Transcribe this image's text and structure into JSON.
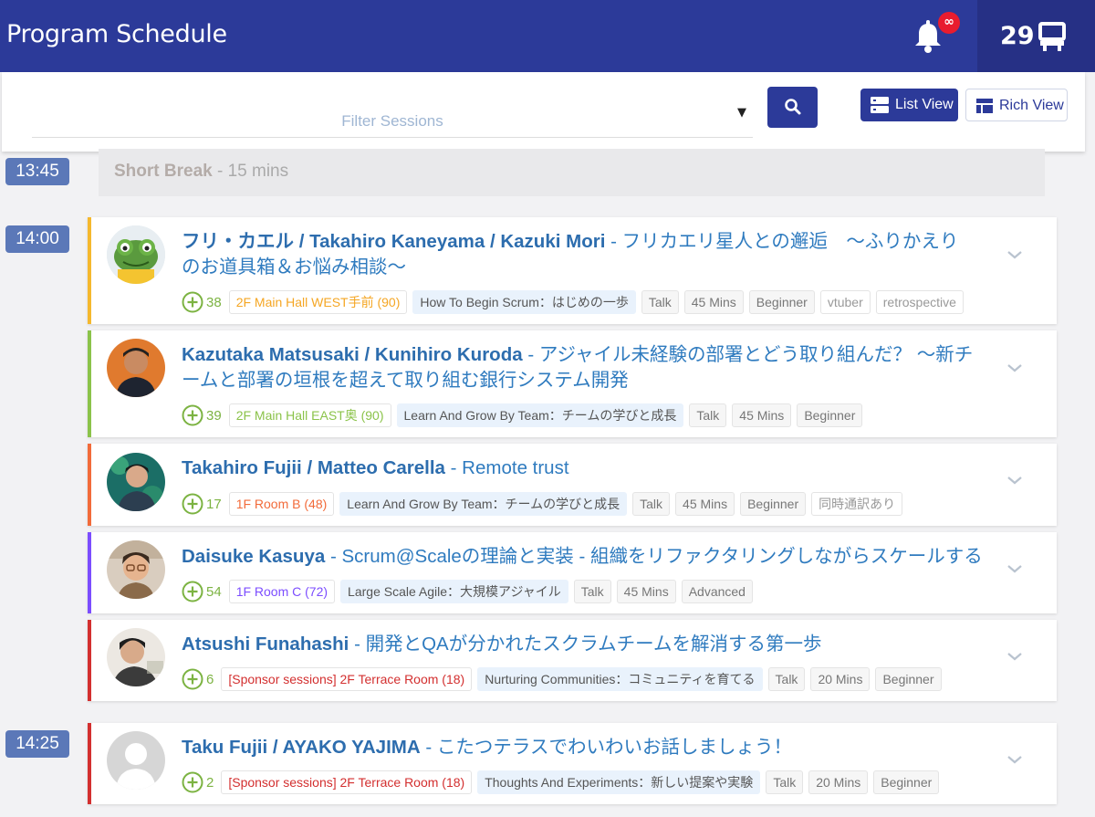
{
  "header": {
    "title": "Program Schedule",
    "notification_badge": "∞",
    "counter": "29",
    "bell_icon": "bell-icon",
    "counter_icon": "desk-icon"
  },
  "filter": {
    "placeholder": "Filter Sessions",
    "search_icon": "search-icon",
    "list_view_label": "List View",
    "rich_view_label": "Rich View"
  },
  "schedule": {
    "break": {
      "time": "13:45",
      "title": "Short Break",
      "duration": " - 15 mins"
    },
    "slots": [
      {
        "time": "14:00",
        "sessions": [
          {
            "speakers": "フリ・カエル / Takahiro Kaneyama / Kazuki Mori",
            "title_line1": " - フリカエリ星人との邂逅　～ふりかえり",
            "title_line2": "のお道具箱＆お悩み相談～",
            "votes": "38",
            "room": "2F Main Hall WEST手前 (90)",
            "track": "How To Begin Scrum：はじめの一歩",
            "format": "Talk",
            "duration": "45 Mins",
            "level": "Beginner",
            "extra1": "vtuber",
            "extra2": "retrospective",
            "color": "#f5b82e"
          },
          {
            "speakers": "Kazutaka Matsusaki / Kunihiro Kuroda",
            "title_line1": " - アジャイル未経験の部署とどう取り組んだ？ ～新チ",
            "title_line2": "ームと部署の垣根を超えて取り組む銀行システム開発",
            "votes": "39",
            "room": "2F Main Hall EAST奥 (90)",
            "track": "Learn And Grow By Team：チームの学びと成長",
            "format": "Talk",
            "duration": "45 Mins",
            "level": "Beginner",
            "color": "#8bc34a"
          },
          {
            "speakers": "Takahiro Fujii / Matteo Carella",
            "title_line1": " - Remote trust",
            "votes": "17",
            "room": "1F Room B (48)",
            "track": "Learn And Grow By Team：チームの学びと成長",
            "format": "Talk",
            "duration": "45 Mins",
            "level": "Beginner",
            "extra1": "同時通訳あり",
            "color": "#f26b3a"
          },
          {
            "speakers": "Daisuke Kasuya",
            "title_line1": " - Scrum@Scaleの理論と実装 - 組織をリファクタリングしながらスケールする",
            "votes": "54",
            "room": "1F Room C (72)",
            "track": "Large Scale Agile：大規模アジャイル",
            "format": "Talk",
            "duration": "45 Mins",
            "level": "Advanced",
            "color": "#7c4dff"
          },
          {
            "speakers": "Atsushi Funahashi",
            "title_line1": " - 開発とQAが分かれたスクラムチームを解消する第一歩",
            "votes": "6",
            "room": "[Sponsor sessions] 2F Terrace Room (18)",
            "track": "Nurturing Communities：コミュニティを育てる",
            "format": "Talk",
            "duration": "20 Mins",
            "level": "Beginner",
            "color": "#d32f2f"
          }
        ]
      },
      {
        "time": "14:25",
        "sessions": [
          {
            "speakers": "Taku Fujii / AYAKO YAJIMA",
            "title_line1": " - こたつテラスでわいわいお話しましょう！",
            "votes": "2",
            "room": "[Sponsor sessions] 2F Terrace Room (18)",
            "track": "Thoughts And Experiments：新しい提案や実験",
            "format": "Talk",
            "duration": "20 Mins",
            "level": "Beginner",
            "color": "#d32f2f"
          }
        ]
      }
    ]
  }
}
